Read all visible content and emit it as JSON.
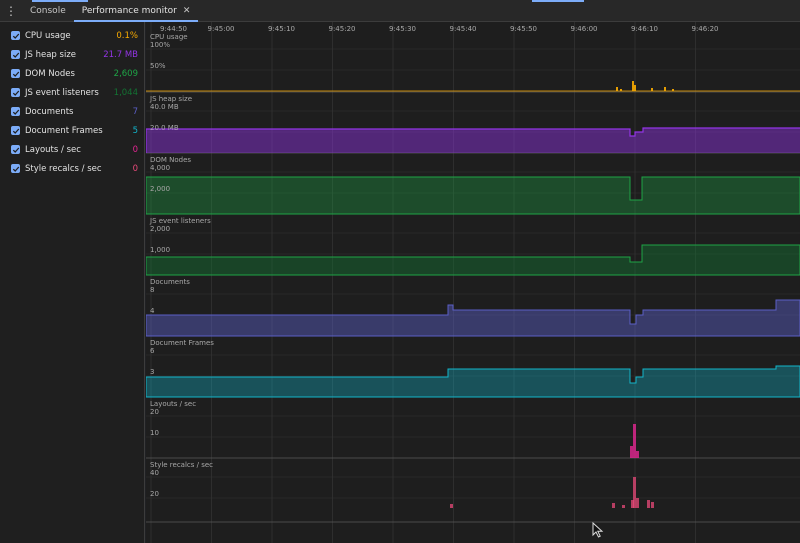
{
  "tabs": [
    {
      "label": "Console"
    },
    {
      "label": "Performance monitor"
    }
  ],
  "metrics": [
    {
      "label": "CPU usage",
      "value": "0.1%",
      "color": "#f9ab00"
    },
    {
      "label": "JS heap size",
      "value": "21.7 MB",
      "color": "#9334e6"
    },
    {
      "label": "DOM Nodes",
      "value": "2,609",
      "color": "#1ea446"
    },
    {
      "label": "JS event listeners",
      "value": "1,044",
      "color": "#137333"
    },
    {
      "label": "Documents",
      "value": "7",
      "color": "#5b5fc7"
    },
    {
      "label": "Document Frames",
      "value": "5",
      "color": "#12b5cb"
    },
    {
      "label": "Layouts / sec",
      "value": "0",
      "color": "#e52592"
    },
    {
      "label": "Style recalcs / sec",
      "value": "0",
      "color": "#e94a7a"
    }
  ],
  "time_ticks": [
    "9:44:50",
    "9:45:00",
    "9:45:10",
    "9:45:20",
    "9:45:30",
    "9:45:40",
    "9:45:50",
    "9:46:00",
    "9:46:10",
    "9:46:20"
  ],
  "graphs": [
    {
      "title": "CPU usage",
      "scale_labels": [
        "100%",
        "50%"
      ]
    },
    {
      "title": "JS heap size",
      "scale_labels": [
        "40.0 MB",
        "20.0 MB"
      ]
    },
    {
      "title": "DOM Nodes",
      "scale_labels": [
        "4,000",
        "2,000"
      ]
    },
    {
      "title": "JS event listeners",
      "scale_labels": [
        "2,000",
        "1,000"
      ]
    },
    {
      "title": "Documents",
      "scale_labels": [
        "8",
        "4"
      ]
    },
    {
      "title": "Document Frames",
      "scale_labels": [
        "6",
        "3"
      ]
    },
    {
      "title": "Layouts / sec",
      "scale_labels": [
        "20",
        "10"
      ]
    },
    {
      "title": "Style recalcs / sec",
      "scale_labels": [
        "40",
        "20"
      ]
    }
  ]
}
